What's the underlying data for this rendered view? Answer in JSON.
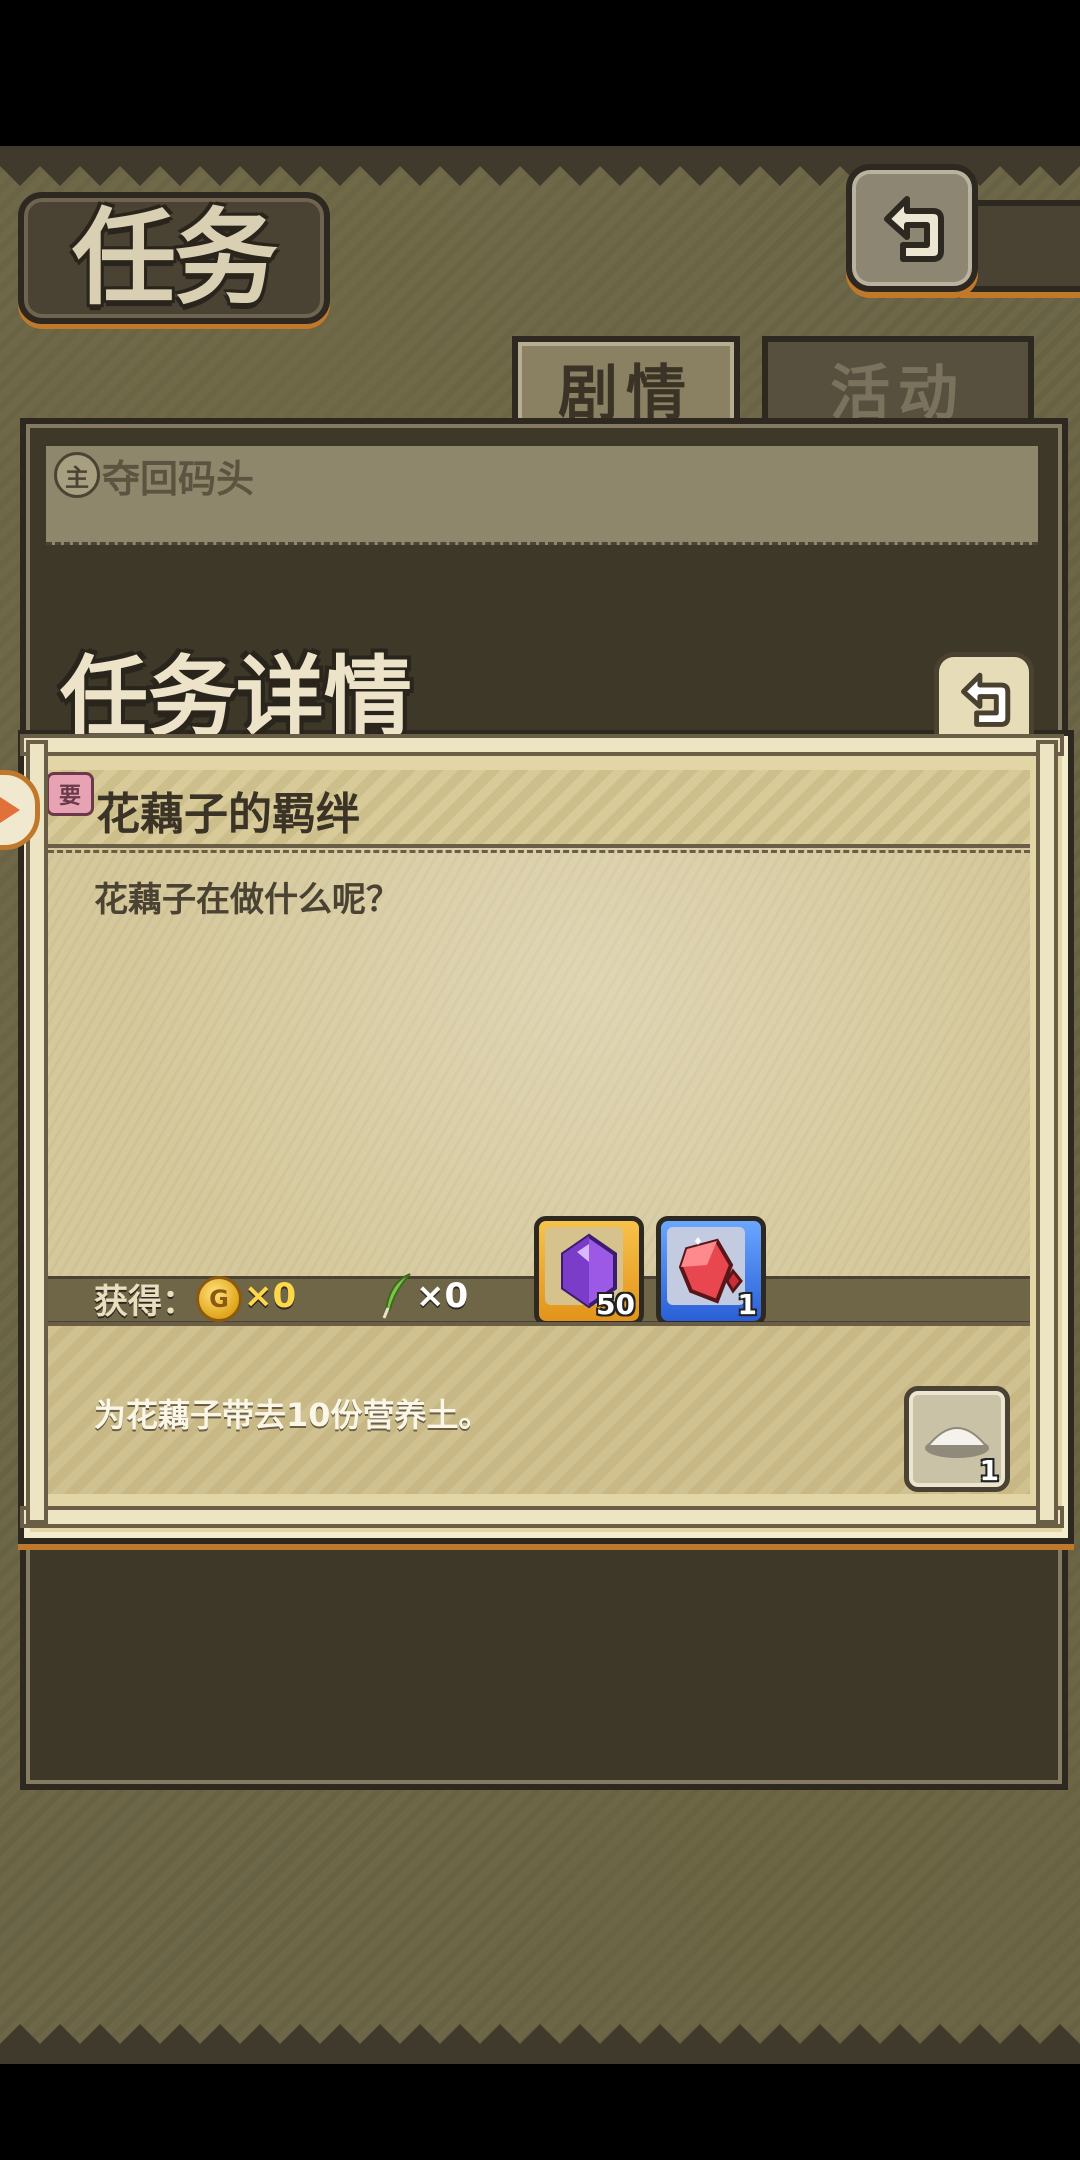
{
  "header": {
    "title": "任务",
    "back_icon": "return-arrow-icon"
  },
  "tabs": [
    {
      "label": "剧情",
      "active": true
    },
    {
      "label": "活动",
      "active": false
    }
  ],
  "background_quest": {
    "icon_text": "主",
    "title": "夺回码头"
  },
  "detail": {
    "title": "任务详情",
    "back_icon": "return-arrow-icon",
    "quest_icon_text": "要",
    "quest_title": "花藕子的羁绊",
    "quest_description": "花藕子在做什么呢？",
    "reward_label": "获得：",
    "coin_icon_text": "G",
    "coin_count": "×0",
    "feather_count": "×0",
    "reward_items": [
      {
        "name": "purple-crystal",
        "qty": "50",
        "frame": "#f2b233"
      },
      {
        "name": "red-gem-shard",
        "qty": "1",
        "frame": "#3f7be8"
      }
    ],
    "goal_text": "为花藕子带去10份营养土。",
    "goal_item_qty": "1"
  },
  "colors": {
    "orange_accent": "#c0782a",
    "parchment": "#d5c89b",
    "dark_frame": "#2d2820"
  }
}
